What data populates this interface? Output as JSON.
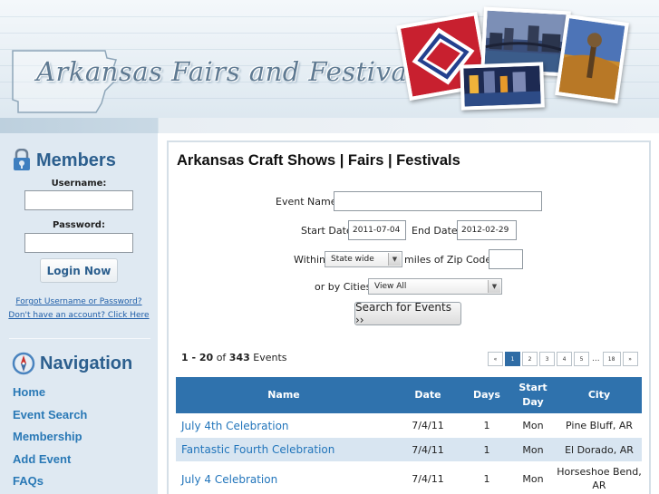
{
  "header": {
    "site_title": "Arkansas Fairs and Festivals"
  },
  "sidebar": {
    "members": {
      "heading": "Members",
      "username_label": "Username:",
      "password_label": "Password:",
      "login_label": "Login Now",
      "forgot_link": "Forgot Username or Password?",
      "signup_link": "Don't have an account? Click Here"
    },
    "navigation": {
      "heading": "Navigation",
      "items": [
        "Home",
        "Event Search",
        "Membership",
        "Add Event",
        "FAQs"
      ]
    }
  },
  "main": {
    "title": "Arkansas Craft Shows | Fairs | Festivals",
    "form": {
      "event_name_label": "Event Name",
      "event_name_value": "",
      "start_date_label": "Start Date",
      "start_date_value": "2011-07-04",
      "end_date_label": "End Date",
      "end_date_value": "2012-02-29",
      "within_label": "Within",
      "within_value": "State wide",
      "zip_label": "miles of Zip Code:",
      "zip_value": "",
      "cities_label": "or by Cities",
      "cities_value": "View All",
      "search_label": "Search for Events ››"
    },
    "results": {
      "range": "1 - 20",
      "of_text": "of",
      "total": "343",
      "suffix": "Events"
    },
    "pager": {
      "prev": "«",
      "pages": [
        "1",
        "2",
        "3",
        "4",
        "5"
      ],
      "ellipsis": "...",
      "last": "18",
      "next": "»",
      "current": "1"
    },
    "table": {
      "headers": [
        "Name",
        "Date",
        "Days",
        "Start\nDay",
        "City"
      ],
      "header_start_day_line1": "Start",
      "header_start_day_line2": "Day",
      "rows": [
        {
          "name": "July 4th Celebration",
          "date": "7/4/11",
          "days": "1",
          "start_day": "Mon",
          "city": "Pine Bluff, AR"
        },
        {
          "name": "Fantastic Fourth Celebration",
          "date": "7/4/11",
          "days": "1",
          "start_day": "Mon",
          "city": "El Dorado, AR"
        },
        {
          "name": "July 4 Celebration",
          "date": "7/4/11",
          "days": "1",
          "start_day": "Mon",
          "city_line1": "Horseshoe Bend,",
          "city_line2": "AR"
        }
      ]
    }
  },
  "colors": {
    "brand_blue": "#2c5f8e",
    "link_blue": "#2275bb",
    "table_header": "#2f72ad",
    "row_alt": "#d8e5f1",
    "sidebar_bg": "#dfe9f2"
  },
  "icons": {
    "members": "lock-user-icon",
    "navigation": "compass-icon",
    "dropdown": "chevron-down-icon"
  }
}
